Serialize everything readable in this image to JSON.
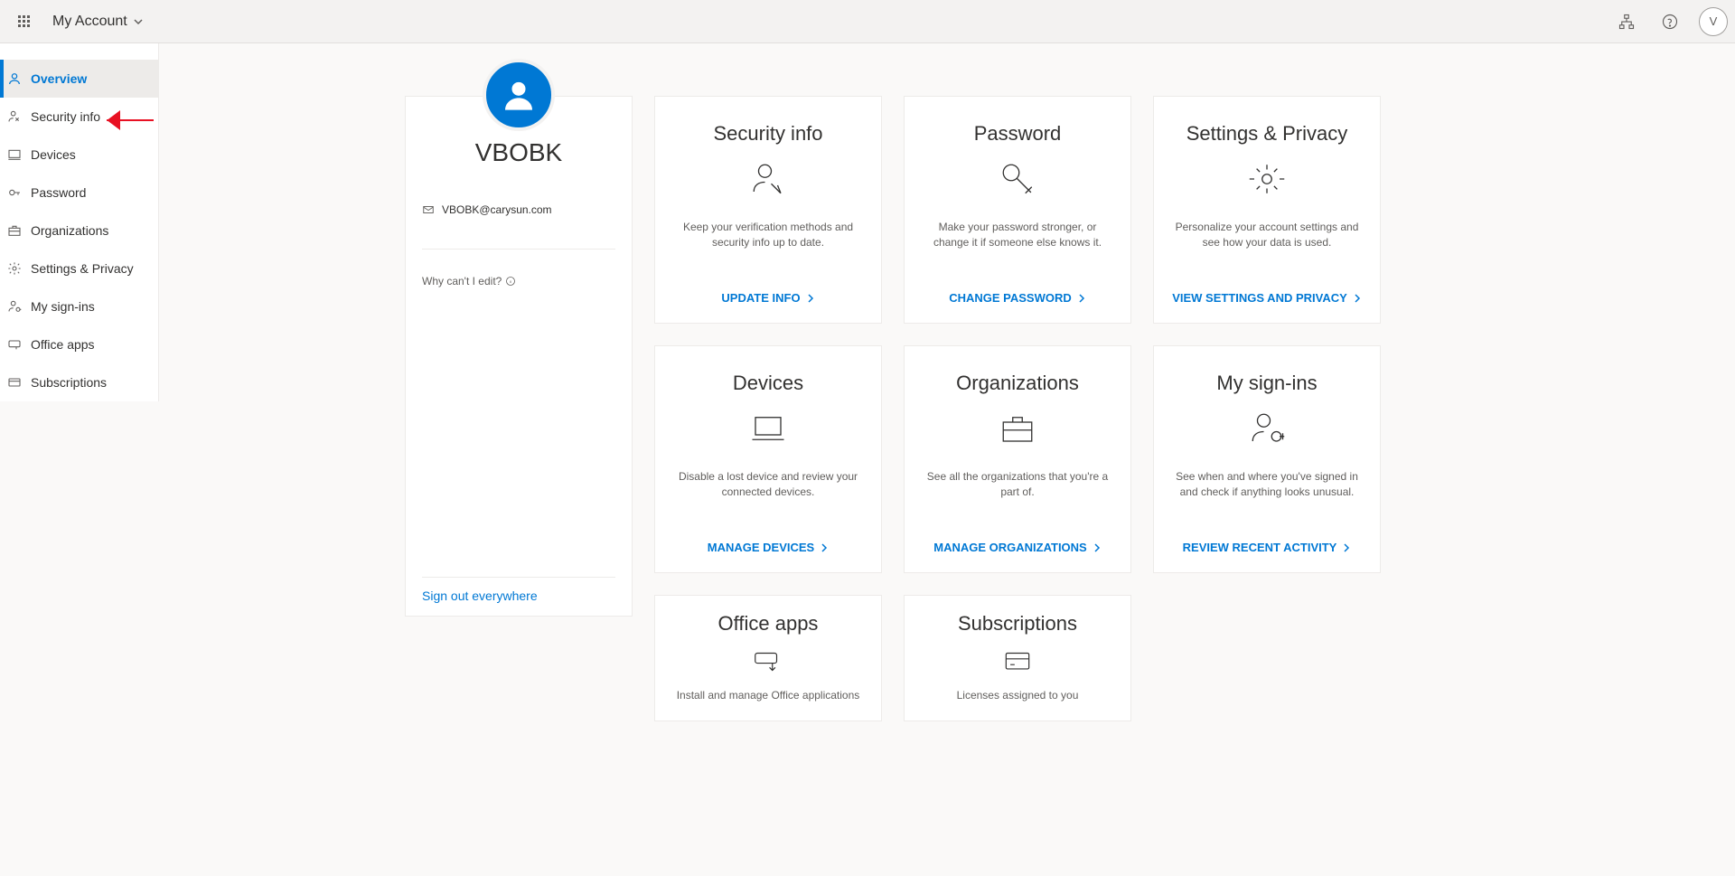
{
  "header": {
    "title": "My Account",
    "avatar_initial": "V"
  },
  "sidebar": {
    "items": [
      {
        "label": "Overview"
      },
      {
        "label": "Security info"
      },
      {
        "label": "Devices"
      },
      {
        "label": "Password"
      },
      {
        "label": "Organizations"
      },
      {
        "label": "Settings & Privacy"
      },
      {
        "label": "My sign-ins"
      },
      {
        "label": "Office apps"
      },
      {
        "label": "Subscriptions"
      }
    ]
  },
  "profile": {
    "name": "VBOBK",
    "email": "VBOBK@carysun.com",
    "hint": "Why can't I edit?",
    "signout": "Sign out everywhere"
  },
  "tiles": {
    "security": {
      "title": "Security info",
      "desc": "Keep your verification methods and security info up to date.",
      "action": "UPDATE INFO"
    },
    "password": {
      "title": "Password",
      "desc": "Make your password stronger, or change it if someone else knows it.",
      "action": "CHANGE PASSWORD"
    },
    "settings": {
      "title": "Settings & Privacy",
      "desc": "Personalize your account settings and see how your data is used.",
      "action": "VIEW SETTINGS AND PRIVACY"
    },
    "devices": {
      "title": "Devices",
      "desc": "Disable a lost device and review your connected devices.",
      "action": "MANAGE DEVICES"
    },
    "organizations": {
      "title": "Organizations",
      "desc": "See all the organizations that you're a part of.",
      "action": "MANAGE ORGANIZATIONS"
    },
    "signins": {
      "title": "My sign-ins",
      "desc": "See when and where you've signed in and check if anything looks unusual.",
      "action": "REVIEW RECENT ACTIVITY"
    },
    "office": {
      "title": "Office apps",
      "desc": "Install and manage Office applications"
    },
    "subscriptions": {
      "title": "Subscriptions",
      "desc": "Licenses assigned to you"
    }
  }
}
